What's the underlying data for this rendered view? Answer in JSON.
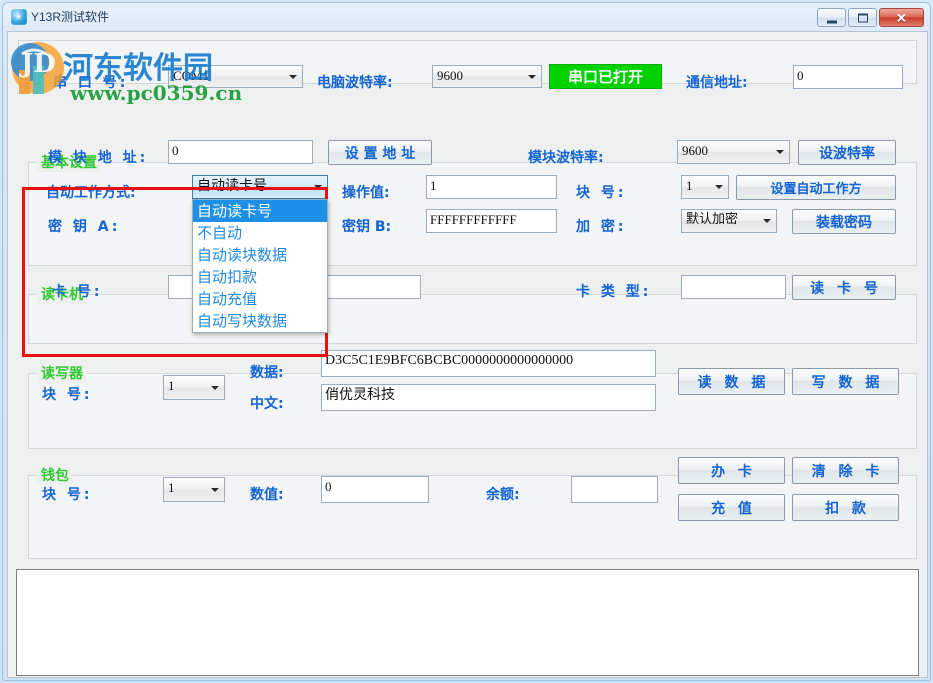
{
  "window": {
    "title": "Y13R测试软件",
    "icon": "app-star-icon",
    "buttons": {
      "minimize": "minimize-icon",
      "maximize": "maximize-icon",
      "close": "✕"
    }
  },
  "watermark": {
    "main_text": "河东软件园",
    "url_text": "www.pc0359.cn",
    "colors": {
      "blue": "#1c7fd0",
      "green": "#1f9e3d",
      "orange": "#f0932a",
      "teal": "#3fb6b6"
    }
  },
  "serial_bar": {
    "port_label": "串 口 号:",
    "port_value": "COM1",
    "pc_baud_label": "电脑波特率:",
    "pc_baud_value": "9600",
    "open_status_button": "串口已打开",
    "comm_addr_label": "通信地址:",
    "comm_addr_value": "0"
  },
  "basic_settings": {
    "legend": "基本设置",
    "module_addr_label": "模 块 地 址:",
    "module_addr_value": "0",
    "set_addr_button": "设 置 地 址",
    "module_baud_label": "模块波特率:",
    "module_baud_value": "9600",
    "set_baud_button": "设波特率",
    "auto_mode_label": "自动工作方式:",
    "auto_mode_value": "自动读卡号",
    "auto_mode_options": [
      "自动读卡号",
      "不自动",
      "自动读块数据",
      "自动扣款",
      "自动充值",
      "自动写块数据"
    ],
    "auto_mode_selected_index": 0,
    "op_value_label": "操作值:",
    "op_value": "1",
    "block_no_label": "块 号:",
    "block_no_value": "1",
    "set_auto_mode_button": "设置自动工作方",
    "key_a_label": "密 钥 A:",
    "key_a_value": "",
    "key_b_label": "密钥 B:",
    "key_b_value": "FFFFFFFFFFFF",
    "encrypt_label": "加 密:",
    "encrypt_value": "默认加密",
    "load_password_button": "装载密码"
  },
  "card_reader": {
    "legend": "读卡机",
    "card_no_label": "卡 号:",
    "card_no_value": "",
    "card_type_label": "卡 类 型:",
    "card_type_value": "",
    "read_card_button": "读 卡 号"
  },
  "reader_writer": {
    "legend": "读写器",
    "block_no_label": "块 号:",
    "block_no_value": "1",
    "data_label": "数据:",
    "data_value": "D3C5C1E9BFC6BCBC0000000000000000",
    "chinese_label": "中文:",
    "chinese_value": "俏优灵科技",
    "read_data_button": "读 数 据",
    "write_data_button": "写 数 据"
  },
  "wallet": {
    "legend": "钱包",
    "block_no_label": "块 号:",
    "block_no_value": "1",
    "amount_label": "数值:",
    "amount_value": "0",
    "balance_label": "余额:",
    "balance_value": "",
    "issue_card_button": "办 卡",
    "clear_card_button": "清 除 卡",
    "recharge_button": "充 值",
    "deduct_button": "扣 款"
  },
  "log": {
    "content": ""
  },
  "colors": {
    "label_blue": "#1464d2",
    "legend_green": "#32c832",
    "status_green": "#00d200",
    "annotation_red": "#e81010",
    "dropdown_highlight": "#1e90e8"
  }
}
